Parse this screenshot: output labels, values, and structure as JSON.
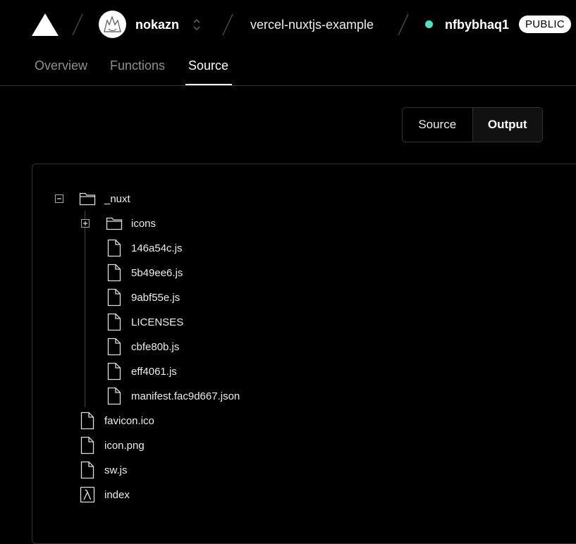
{
  "header": {
    "team": "nokazn",
    "project": "vercel-nuxtjs-example",
    "deployment": "nfbybhaq1",
    "visibility_badge": "PUBLIC",
    "status_color": "#50e3c2"
  },
  "tabs": [
    {
      "label": "Overview",
      "active": false
    },
    {
      "label": "Functions",
      "active": false
    },
    {
      "label": "Source",
      "active": true
    }
  ],
  "view_toggle": {
    "options": [
      "Source",
      "Output"
    ],
    "selected": "Output"
  },
  "file_tree": [
    {
      "name": "_nuxt",
      "type": "folder",
      "depth": 0,
      "expanded": true
    },
    {
      "name": "icons",
      "type": "folder",
      "depth": 1,
      "expanded": false
    },
    {
      "name": "146a54c.js",
      "type": "file",
      "depth": 1
    },
    {
      "name": "5b49ee6.js",
      "type": "file",
      "depth": 1
    },
    {
      "name": "9abf55e.js",
      "type": "file",
      "depth": 1
    },
    {
      "name": "LICENSES",
      "type": "file",
      "depth": 1
    },
    {
      "name": "cbfe80b.js",
      "type": "file",
      "depth": 1
    },
    {
      "name": "eff4061.js",
      "type": "file",
      "depth": 1
    },
    {
      "name": "manifest.fac9d667.json",
      "type": "file",
      "depth": 1
    },
    {
      "name": "favicon.ico",
      "type": "file",
      "depth": 0
    },
    {
      "name": "icon.png",
      "type": "file",
      "depth": 0
    },
    {
      "name": "sw.js",
      "type": "file",
      "depth": 0
    },
    {
      "name": "index",
      "type": "lambda",
      "depth": 0
    }
  ]
}
